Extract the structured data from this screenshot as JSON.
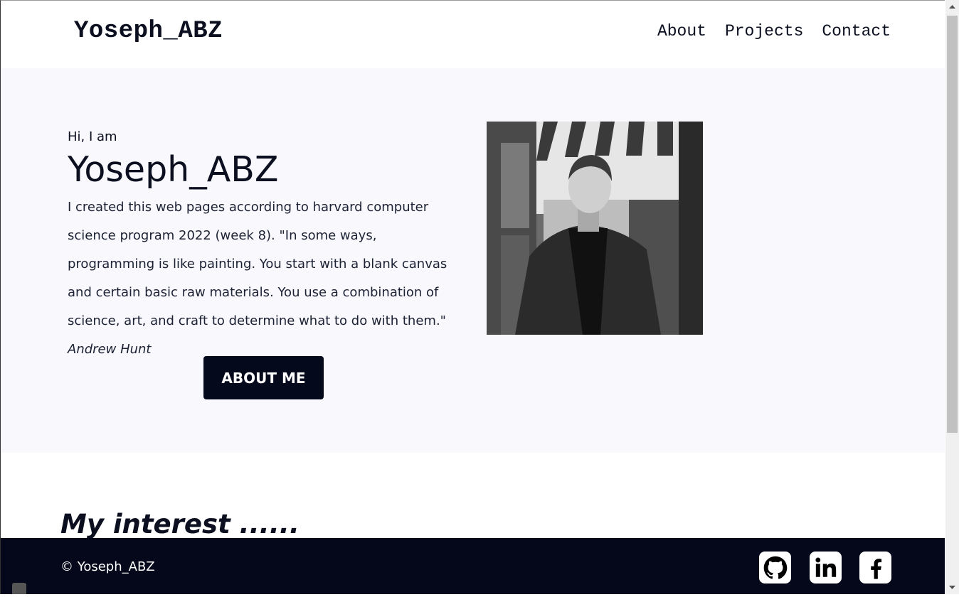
{
  "header": {
    "brand": "Yoseph_ABZ",
    "nav": [
      "About",
      "Projects",
      "Contact"
    ]
  },
  "hero": {
    "greeting": "Hi, I am",
    "name": "Yoseph_ABZ",
    "description": "I created this web pages according to harvard computer science program 2022 (week 8). \"In some ways, programming is like painting. You start with a blank canvas and certain basic raw materials. You use a combination of science, art, and craft to determine what to do with them.\"",
    "quote_author": "Andrew Hunt",
    "button_label": "ABOUT ME",
    "photo_icon": "profile-photo-icon"
  },
  "interest": {
    "heading": "My interest ......"
  },
  "footer": {
    "copyright": "© Yoseph_ABZ",
    "social": [
      "github-icon",
      "linkedin-icon",
      "facebook-icon"
    ]
  },
  "colors": {
    "dark": "#04081a",
    "hero_bg": "#f8f8fd",
    "text": "#0b0f1f"
  }
}
